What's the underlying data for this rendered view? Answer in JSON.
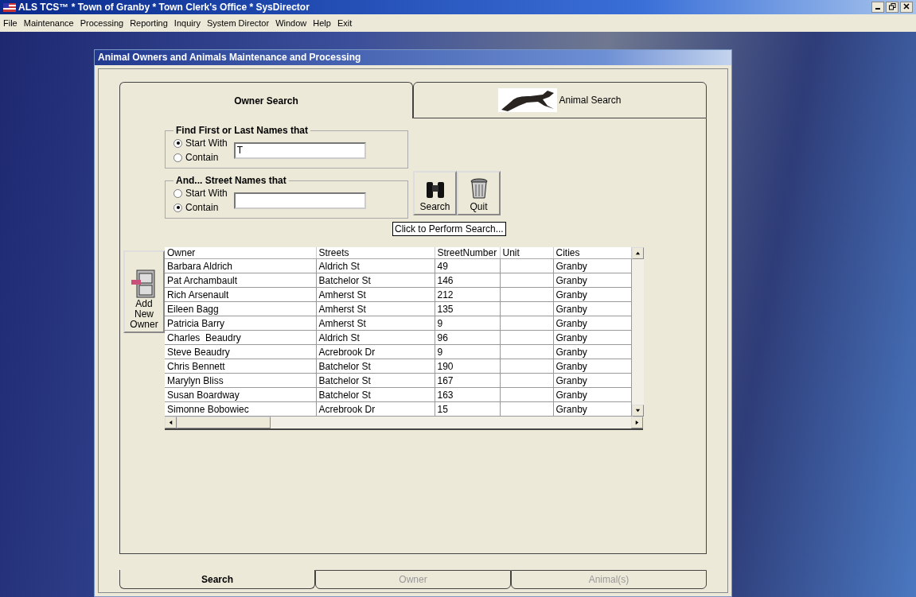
{
  "app_title": "ALS TCS™ * Town of Granby * Town Clerk's Office * SysDirector",
  "menu": [
    "File",
    "Maintenance",
    "Processing",
    "Reporting",
    "Inquiry",
    "System Director",
    "Window",
    "Help",
    "Exit"
  ],
  "window": {
    "title": "Animal Owners and Animals Maintenance and Processing"
  },
  "top_tabs": [
    {
      "label": "Owner Search",
      "selected": true,
      "kind": "text"
    },
    {
      "label": "Animal Search",
      "selected": false,
      "kind": "picture"
    }
  ],
  "name_group": {
    "title": "Find First or Last Names that",
    "options": [
      {
        "label": "Start With",
        "selected": true
      },
      {
        "label": "Contain",
        "selected": false
      }
    ],
    "value": "T"
  },
  "street_group": {
    "title": "And... Street Names that",
    "options": [
      {
        "label": "Start With",
        "selected": false
      },
      {
        "label": "Contain",
        "selected": true
      }
    ]
  },
  "actions": [
    {
      "label": "Search",
      "kind": "search"
    },
    {
      "label": "Quit",
      "kind": "quit"
    }
  ],
  "tooltip": "Click to Perform Search...",
  "add_owner": {
    "label": "Add New Owner"
  },
  "table": {
    "columns": [
      "Owner",
      "Streets",
      "StreetNumber",
      "Unit",
      "Cities"
    ],
    "rows": [
      [
        "Barbara Aldrich",
        "Aldrich St",
        "49",
        "",
        "Granby"
      ],
      [
        "Pat Archambault",
        "Batchelor St",
        "146",
        "",
        "Granby"
      ],
      [
        "Rich Arsenault",
        "Amherst St",
        "212",
        "",
        "Granby"
      ],
      [
        "Eileen Bagg",
        "Amherst St",
        "135",
        "",
        "Granby"
      ],
      [
        "Patricia Barry",
        "Amherst St",
        "9",
        "",
        "Granby"
      ],
      [
        "Charles  Beaudry",
        "Aldrich St",
        "96",
        "",
        "Granby"
      ],
      [
        "Steve Beaudry",
        "Acrebrook Dr",
        "9",
        "",
        "Granby"
      ],
      [
        "Chris Bennett",
        "Batchelor St",
        "190",
        "",
        "Granby"
      ],
      [
        "Marylyn Bliss",
        "Batchelor St",
        "167",
        "",
        "Granby"
      ],
      [
        "Susan Boardway",
        "Batchelor St",
        "163",
        "",
        "Granby"
      ],
      [
        "Simonne Bobowiec",
        "Acrebrook Dr",
        "15",
        "",
        "Granby"
      ]
    ]
  },
  "bottom_tabs": [
    {
      "label": "Search",
      "selected": true,
      "disabled": false
    },
    {
      "label": "Owner",
      "selected": false,
      "disabled": true
    },
    {
      "label": "Animal(s)",
      "selected": false,
      "disabled": true
    }
  ]
}
